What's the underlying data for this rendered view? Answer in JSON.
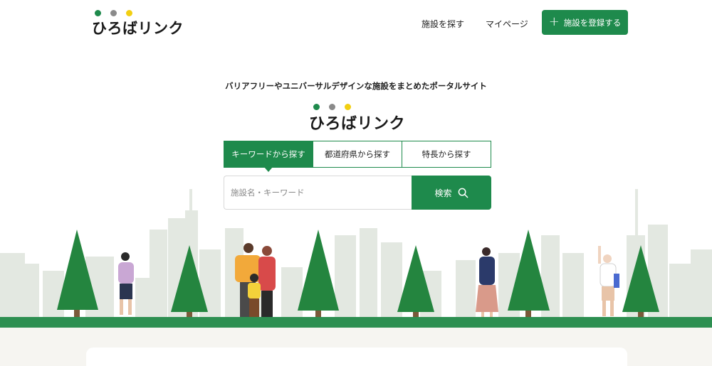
{
  "header": {
    "logo_text": "ひろばリンク",
    "nav": [
      {
        "label": "施設を探す"
      },
      {
        "label": "マイページ"
      }
    ],
    "register_button": "施設を登録する"
  },
  "hero": {
    "tagline": "バリアフリーやユニバーサルデザインな施設をまとめたポータルサイト",
    "logo_text": "ひろばリンク",
    "tabs": [
      {
        "label": "キーワードから探す",
        "active": true
      },
      {
        "label": "都道府県から探す",
        "active": false
      },
      {
        "label": "特長から探す",
        "active": false
      }
    ],
    "search": {
      "placeholder": "施設名・キーワード",
      "button_label": "検索"
    }
  },
  "colors": {
    "brand_green": "#1e8a4c",
    "dot_green": "#1e8a4c",
    "dot_gray": "#8a8a8a",
    "dot_yellow": "#f2cf12",
    "ground": "#2d8f51",
    "skyline": "#e3e8e1",
    "tree": "#24853f"
  },
  "icons": [
    "plus-icon",
    "search-icon"
  ]
}
